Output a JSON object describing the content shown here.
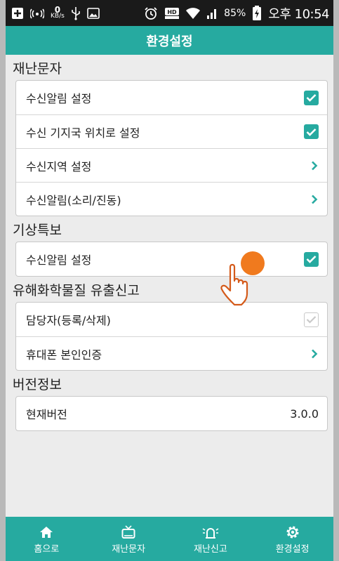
{
  "statusbar": {
    "speed_value": "0",
    "speed_unit": "KB/s",
    "battery": "85%",
    "clock": "오후 10:54"
  },
  "header": {
    "title": "환경설정"
  },
  "sections": [
    {
      "title": "재난문자",
      "rows": [
        {
          "label": "수신알림 설정",
          "control": "checkbox",
          "checked": true
        },
        {
          "label": "수신 기지국 위치로 설정",
          "control": "checkbox",
          "checked": true
        },
        {
          "label": "수신지역 설정",
          "control": "chevron"
        },
        {
          "label": "수신알림(소리/진동)",
          "control": "chevron"
        }
      ]
    },
    {
      "title": "기상특보",
      "rows": [
        {
          "label": "수신알림 설정",
          "control": "checkbox",
          "checked": true
        }
      ]
    },
    {
      "title": "유해화학물질 유출신고",
      "rows": [
        {
          "label": "담당자(등록/삭제)",
          "control": "checkbox",
          "checked": true,
          "disabled": true
        },
        {
          "label": "휴대폰 본인인증",
          "control": "chevron"
        }
      ]
    },
    {
      "title": "버전정보",
      "rows": [
        {
          "label": "현재버전",
          "control": "value",
          "value": "3.0.0"
        }
      ]
    }
  ],
  "bottomnav": {
    "items": [
      {
        "label": "홈으로",
        "icon": "home-icon"
      },
      {
        "label": "재난문자",
        "icon": "tv-icon"
      },
      {
        "label": "재난신고",
        "icon": "siren-icon"
      },
      {
        "label": "환경설정",
        "icon": "gear-icon"
      }
    ]
  },
  "colors": {
    "accent": "#26aaa0",
    "background": "#ececec",
    "statusbar": "#1a1a1a"
  }
}
